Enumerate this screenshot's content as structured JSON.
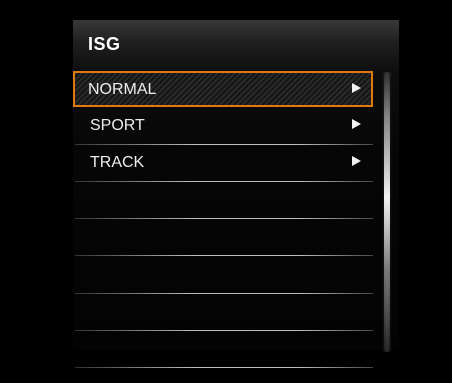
{
  "header": {
    "title": "ISG"
  },
  "menu": {
    "items": [
      {
        "label": "NORMAL",
        "selected": true,
        "has_submenu": true,
        "arrow_icon": "right-triangle-icon"
      },
      {
        "label": "SPORT",
        "selected": false,
        "has_submenu": true,
        "arrow_icon": "right-triangle-icon"
      },
      {
        "label": "TRACK",
        "selected": false,
        "has_submenu": true,
        "arrow_icon": "right-triangle-icon"
      },
      {
        "label": "",
        "selected": false,
        "has_submenu": false
      },
      {
        "label": "",
        "selected": false,
        "has_submenu": false
      },
      {
        "label": "",
        "selected": false,
        "has_submenu": false
      },
      {
        "label": "",
        "selected": false,
        "has_submenu": false
      },
      {
        "label": "",
        "selected": false,
        "has_submenu": false
      }
    ]
  },
  "colors": {
    "background": "#000000",
    "selection_border": "#e07a10",
    "text": "#ededed"
  }
}
